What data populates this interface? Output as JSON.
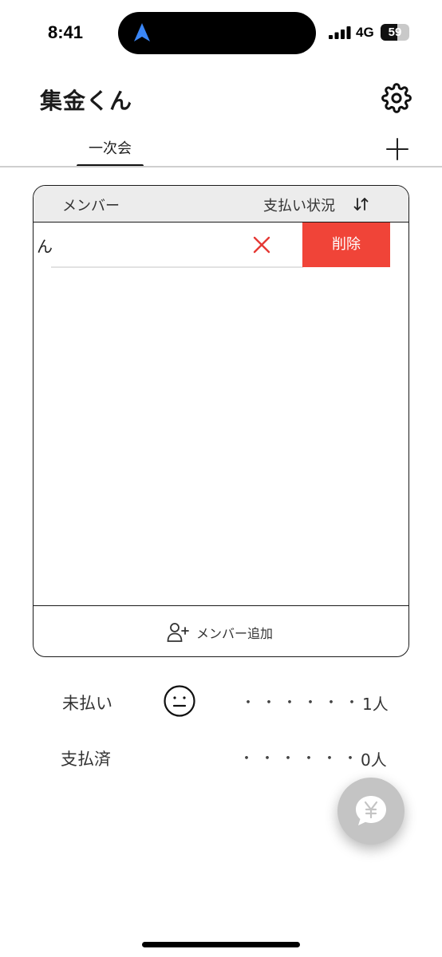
{
  "status_bar": {
    "time": "8:41",
    "network": "4G",
    "battery_percent": "59",
    "battery_level": 0.59
  },
  "header": {
    "title": "集金くん"
  },
  "tabs": [
    {
      "label": "一次会",
      "active": true
    }
  ],
  "table": {
    "header": {
      "member": "メンバー",
      "status": "支払い状況"
    },
    "rows": [
      {
        "name": "ん",
        "status_icon": "cross-icon",
        "delete_label": "削除"
      }
    ],
    "add_member_label": "メンバー追加"
  },
  "summary": {
    "unpaid": {
      "label": "未払い",
      "dots": "・・・・・・",
      "count": "1人"
    },
    "paid": {
      "label": "支払済",
      "dots": "・・・・・・",
      "count": "0人"
    }
  },
  "icons": {
    "settings": "gear-icon",
    "add_tab": "plus-icon",
    "sort": "sort-icon",
    "add_member": "add-user-icon",
    "unpaid_face": "neutral-face-icon",
    "fab": "yen-chat-icon"
  },
  "colors": {
    "delete": "#f04438",
    "cross": "#e53935",
    "header_bg": "#ececec",
    "fab_bg": "#c4c4c4",
    "nav_arrow": "#3a86f7"
  }
}
